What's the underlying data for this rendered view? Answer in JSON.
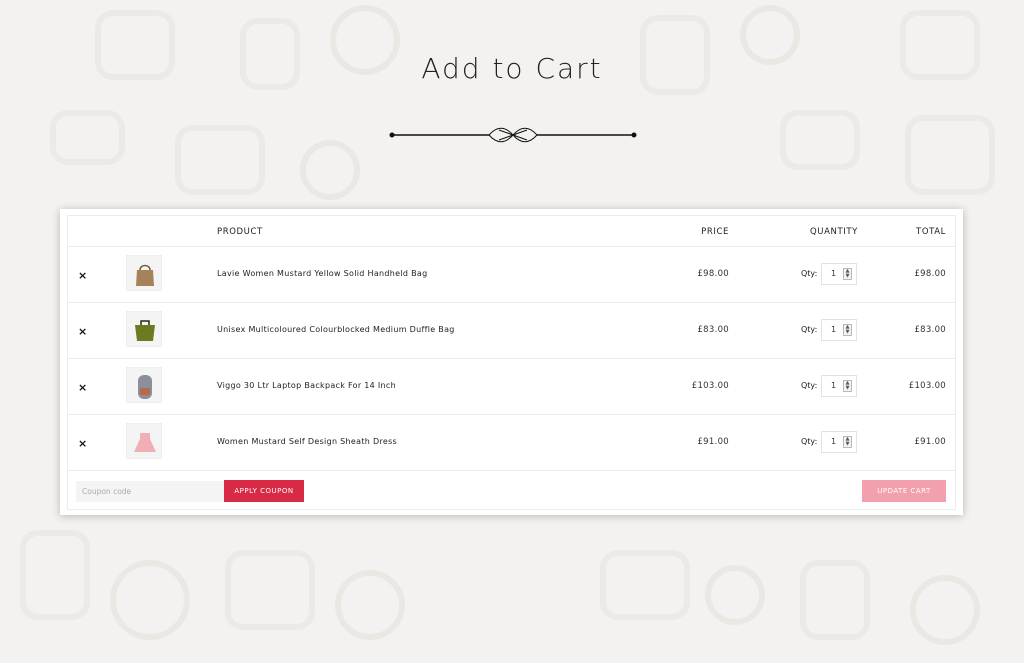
{
  "page": {
    "title": "Add to Cart"
  },
  "colors": {
    "accent": "#d82a45",
    "accent_light": "#f2a0ad",
    "background": "#f3f2f0"
  },
  "table": {
    "headers": {
      "product": "PRODUCT",
      "price": "PRICE",
      "quantity": "QUANTITY",
      "total": "TOTAL"
    },
    "remove_symbol": "×",
    "qty_label": "Qty:",
    "rows": [
      {
        "name": "Lavie Women Mustard Yellow Solid Handheld Bag",
        "price": "£98.00",
        "qty": "1",
        "total": "£98.00",
        "thumb_icon": "handbag-icon",
        "thumb_color": "#a5825a"
      },
      {
        "name": "Unisex Multicoloured Colourblocked Medium Duffle Bag",
        "price": "£83.00",
        "qty": "1",
        "total": "£83.00",
        "thumb_icon": "duffle-bag-icon",
        "thumb_color": "#6d7a1f"
      },
      {
        "name": "Viggo 30 Ltr Laptop Backpack For 14 Inch",
        "price": "£103.00",
        "qty": "1",
        "total": "£103.00",
        "thumb_icon": "backpack-icon",
        "thumb_color": "#8a8f99"
      },
      {
        "name": "Women Mustard Self Design Sheath Dress",
        "price": "£91.00",
        "qty": "1",
        "total": "£91.00",
        "thumb_icon": "dress-icon",
        "thumb_color": "#f2aeb6"
      }
    ]
  },
  "footer": {
    "coupon_placeholder": "Coupon code",
    "apply_label": "APPLY COUPON",
    "update_label": "UPDATE CART"
  }
}
